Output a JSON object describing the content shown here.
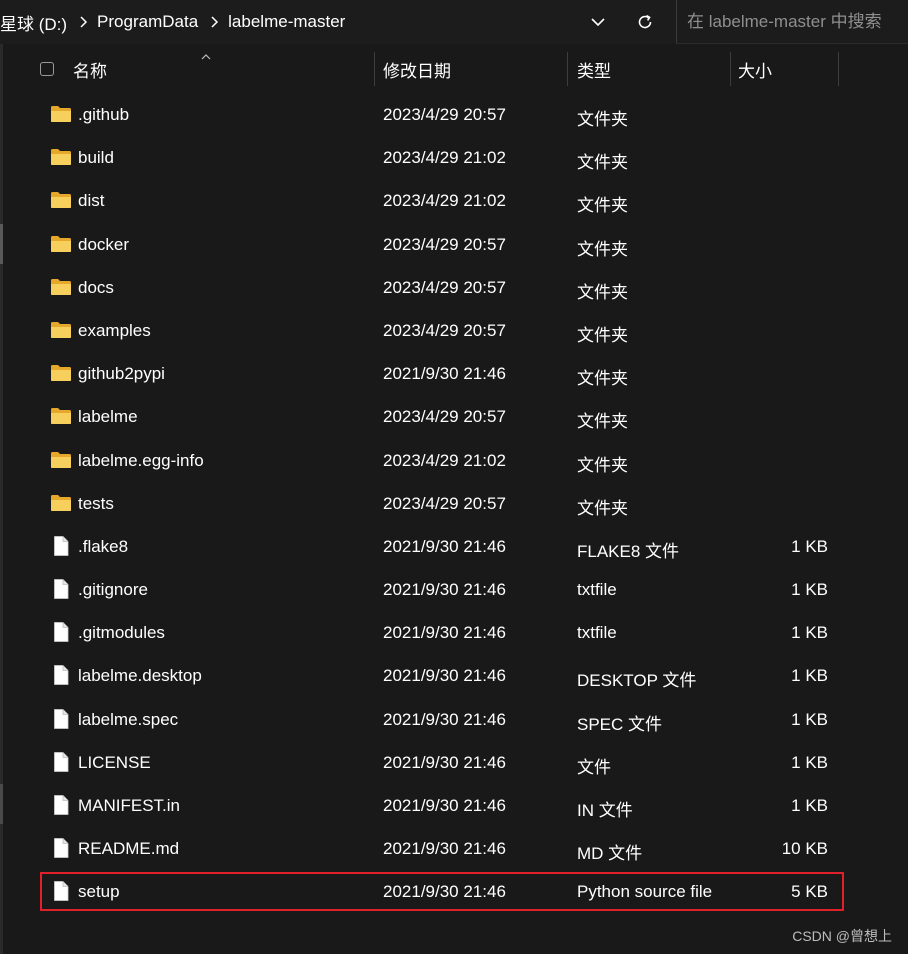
{
  "breadcrumb": {
    "segments": [
      "星球 (D:)",
      "ProgramData",
      "labelme-master"
    ]
  },
  "search": {
    "placeholder": "在 labelme-master 中搜索"
  },
  "columns": {
    "name": "名称",
    "date": "修改日期",
    "type": "类型",
    "size": "大小"
  },
  "files": [
    {
      "name": ".github",
      "date": "2023/4/29 20:57",
      "type": "文件夹",
      "size": "",
      "kind": "folder-icon"
    },
    {
      "name": "build",
      "date": "2023/4/29 21:02",
      "type": "文件夹",
      "size": "",
      "kind": "folder-icon"
    },
    {
      "name": "dist",
      "date": "2023/4/29 21:02",
      "type": "文件夹",
      "size": "",
      "kind": "folder-icon"
    },
    {
      "name": "docker",
      "date": "2023/4/29 20:57",
      "type": "文件夹",
      "size": "",
      "kind": "folder-icon"
    },
    {
      "name": "docs",
      "date": "2023/4/29 20:57",
      "type": "文件夹",
      "size": "",
      "kind": "folder-icon"
    },
    {
      "name": "examples",
      "date": "2023/4/29 20:57",
      "type": "文件夹",
      "size": "",
      "kind": "folder-icon"
    },
    {
      "name": "github2pypi",
      "date": "2021/9/30 21:46",
      "type": "文件夹",
      "size": "",
      "kind": "folder-icon"
    },
    {
      "name": "labelme",
      "date": "2023/4/29 20:57",
      "type": "文件夹",
      "size": "",
      "kind": "folder-icon"
    },
    {
      "name": "labelme.egg-info",
      "date": "2023/4/29 21:02",
      "type": "文件夹",
      "size": "",
      "kind": "folder-icon"
    },
    {
      "name": "tests",
      "date": "2023/4/29 20:57",
      "type": "文件夹",
      "size": "",
      "kind": "folder-icon"
    },
    {
      "name": ".flake8",
      "date": "2021/9/30 21:46",
      "type": "FLAKE8 文件",
      "size": "1 KB",
      "kind": "file-icon"
    },
    {
      "name": ".gitignore",
      "date": "2021/9/30 21:46",
      "type": "txtfile",
      "size": "1 KB",
      "kind": "file-icon"
    },
    {
      "name": ".gitmodules",
      "date": "2021/9/30 21:46",
      "type": "txtfile",
      "size": "1 KB",
      "kind": "file-icon"
    },
    {
      "name": "labelme.desktop",
      "date": "2021/9/30 21:46",
      "type": "DESKTOP 文件",
      "size": "1 KB",
      "kind": "file-icon"
    },
    {
      "name": "labelme.spec",
      "date": "2021/9/30 21:46",
      "type": "SPEC 文件",
      "size": "1 KB",
      "kind": "file-icon"
    },
    {
      "name": "LICENSE",
      "date": "2021/9/30 21:46",
      "type": "文件",
      "size": "1 KB",
      "kind": "file-icon"
    },
    {
      "name": "MANIFEST.in",
      "date": "2021/9/30 21:46",
      "type": "IN 文件",
      "size": "1 KB",
      "kind": "file-icon"
    },
    {
      "name": "README.md",
      "date": "2021/9/30 21:46",
      "type": "MD 文件",
      "size": "10 KB",
      "kind": "file-icon"
    },
    {
      "name": "setup",
      "date": "2021/9/30 21:46",
      "type": "Python source file",
      "size": "5 KB",
      "kind": "file-icon",
      "highlighted": true
    }
  ],
  "watermark": "CSDN @曾想上",
  "colors": {
    "background": "#191919",
    "folder": "#f2c14e",
    "highlight_border": "#e0202a"
  }
}
